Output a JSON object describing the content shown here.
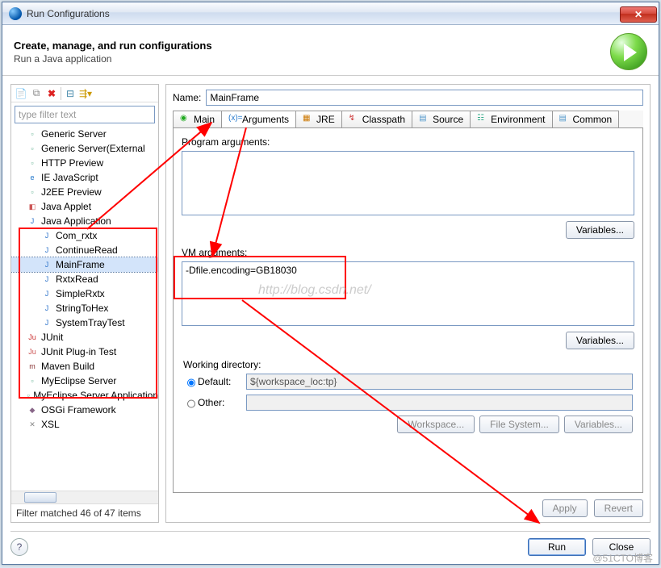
{
  "window": {
    "title": "Run Configurations"
  },
  "header": {
    "title": "Create, manage, and run configurations",
    "subtitle": "Run a Java application"
  },
  "left": {
    "filter_placeholder": "type filter text",
    "items": [
      {
        "label": "Generic Server",
        "icon": "server-icon"
      },
      {
        "label": "Generic Server(External",
        "icon": "server-icon"
      },
      {
        "label": "HTTP Preview",
        "icon": "server-icon"
      },
      {
        "label": "IE JavaScript",
        "icon": "ie-icon"
      },
      {
        "label": "J2EE Preview",
        "icon": "server-icon"
      },
      {
        "label": "Java Applet",
        "icon": "applet-icon"
      },
      {
        "label": "Java Application",
        "icon": "java-app-icon",
        "expanded": true,
        "children": [
          {
            "label": "Com_rxtx"
          },
          {
            "label": "ContinueRead"
          },
          {
            "label": "MainFrame",
            "selected": true
          },
          {
            "label": "RxtxRead"
          },
          {
            "label": "SimpleRxtx"
          },
          {
            "label": "StringToHex"
          },
          {
            "label": "SystemTrayTest"
          }
        ]
      },
      {
        "label": "JUnit",
        "icon": "junit-icon"
      },
      {
        "label": "JUnit Plug-in Test",
        "icon": "junit-plugin-icon"
      },
      {
        "label": "Maven Build",
        "icon": "maven-icon"
      },
      {
        "label": "MyEclipse Server",
        "icon": "server-icon"
      },
      {
        "label": "MyEclipse Server Application",
        "icon": "server-icon"
      },
      {
        "label": "OSGi Framework",
        "icon": "osgi-icon"
      },
      {
        "label": "XSL",
        "icon": "xsl-icon"
      }
    ],
    "status": "Filter matched 46 of 47 items"
  },
  "right": {
    "name_label": "Name:",
    "name_value": "MainFrame",
    "tabs": [
      {
        "label": "Main",
        "icon": "main-icon"
      },
      {
        "label": "Arguments",
        "icon": "args-icon",
        "active": true
      },
      {
        "label": "JRE",
        "icon": "jre-icon"
      },
      {
        "label": "Classpath",
        "icon": "classpath-icon"
      },
      {
        "label": "Source",
        "icon": "source-icon"
      },
      {
        "label": "Environment",
        "icon": "env-icon"
      },
      {
        "label": "Common",
        "icon": "common-icon"
      }
    ],
    "program_args_label": "Program arguments:",
    "program_args_value": "",
    "vm_args_label": "VM arguments:",
    "vm_args_value": "-Dfile.encoding=GB18030",
    "variables_btn": "Variables...",
    "working_dir_label": "Working directory:",
    "wd_default_label": "Default:",
    "wd_default_value": "${workspace_loc:tp}",
    "wd_other_label": "Other:",
    "wd_other_value": "",
    "wd_btns": {
      "workspace": "Workspace...",
      "filesystem": "File System...",
      "variables": "Variables..."
    },
    "apply": "Apply",
    "revert": "Revert"
  },
  "bottom": {
    "run": "Run",
    "close": "Close"
  },
  "watermark_url": "http://blog.csdn.net/",
  "watermark_right": "@51CTO博客"
}
